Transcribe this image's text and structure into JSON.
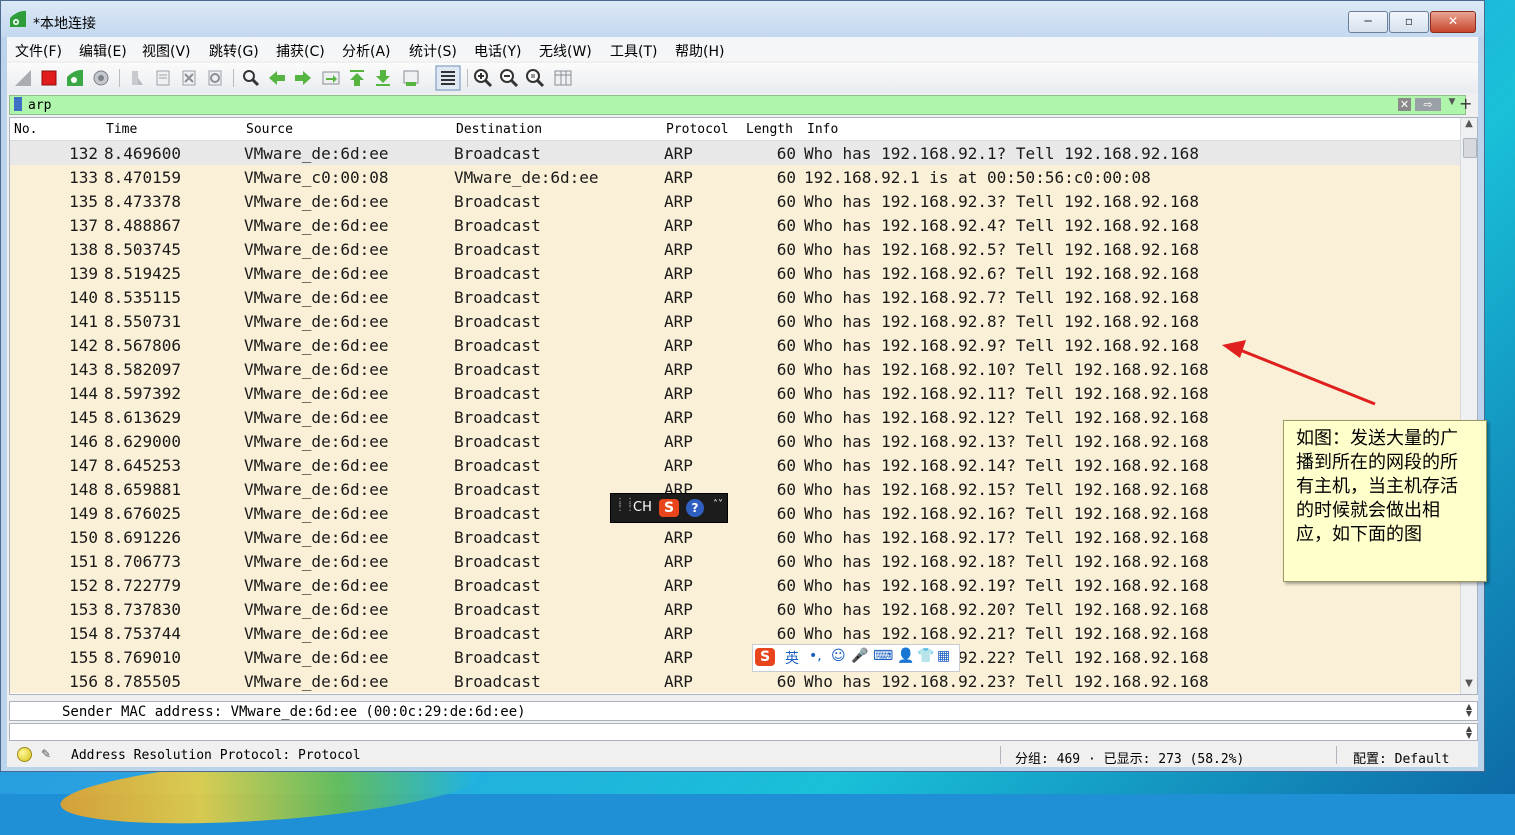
{
  "window": {
    "title": "*本地连接",
    "buttons": {
      "minimize": "─",
      "maximize": "▫",
      "close": "✕"
    }
  },
  "menu": [
    "文件(F)",
    "编辑(E)",
    "视图(V)",
    "跳转(G)",
    "捕获(C)",
    "分析(A)",
    "统计(S)",
    "电话(Y)",
    "无线(W)",
    "工具(T)",
    "帮助(H)"
  ],
  "filter": {
    "value": "arp",
    "clear": "✕",
    "apply": "⇨",
    "dropdown": "▼",
    "add": "+"
  },
  "columns": {
    "no": "No.",
    "time": "Time",
    "source": "Source",
    "destination": "Destination",
    "protocol": "Protocol",
    "length": "Length",
    "info": "Info"
  },
  "packets": [
    {
      "no": "132",
      "time": "8.469600",
      "src": "VMware_de:6d:ee",
      "dst": "Broadcast",
      "proto": "ARP",
      "len": "60",
      "info": "Who has 192.168.92.1? Tell 192.168.92.168"
    },
    {
      "no": "133",
      "time": "8.470159",
      "src": "VMware_c0:00:08",
      "dst": "VMware_de:6d:ee",
      "proto": "ARP",
      "len": "60",
      "info": "192.168.92.1 is at 00:50:56:c0:00:08"
    },
    {
      "no": "135",
      "time": "8.473378",
      "src": "VMware_de:6d:ee",
      "dst": "Broadcast",
      "proto": "ARP",
      "len": "60",
      "info": "Who has 192.168.92.3? Tell 192.168.92.168"
    },
    {
      "no": "137",
      "time": "8.488867",
      "src": "VMware_de:6d:ee",
      "dst": "Broadcast",
      "proto": "ARP",
      "len": "60",
      "info": "Who has 192.168.92.4? Tell 192.168.92.168"
    },
    {
      "no": "138",
      "time": "8.503745",
      "src": "VMware_de:6d:ee",
      "dst": "Broadcast",
      "proto": "ARP",
      "len": "60",
      "info": "Who has 192.168.92.5? Tell 192.168.92.168"
    },
    {
      "no": "139",
      "time": "8.519425",
      "src": "VMware_de:6d:ee",
      "dst": "Broadcast",
      "proto": "ARP",
      "len": "60",
      "info": "Who has 192.168.92.6? Tell 192.168.92.168"
    },
    {
      "no": "140",
      "time": "8.535115",
      "src": "VMware_de:6d:ee",
      "dst": "Broadcast",
      "proto": "ARP",
      "len": "60",
      "info": "Who has 192.168.92.7? Tell 192.168.92.168"
    },
    {
      "no": "141",
      "time": "8.550731",
      "src": "VMware_de:6d:ee",
      "dst": "Broadcast",
      "proto": "ARP",
      "len": "60",
      "info": "Who has 192.168.92.8? Tell 192.168.92.168"
    },
    {
      "no": "142",
      "time": "8.567806",
      "src": "VMware_de:6d:ee",
      "dst": "Broadcast",
      "proto": "ARP",
      "len": "60",
      "info": "Who has 192.168.92.9? Tell 192.168.92.168"
    },
    {
      "no": "143",
      "time": "8.582097",
      "src": "VMware_de:6d:ee",
      "dst": "Broadcast",
      "proto": "ARP",
      "len": "60",
      "info": "Who has 192.168.92.10? Tell 192.168.92.168"
    },
    {
      "no": "144",
      "time": "8.597392",
      "src": "VMware_de:6d:ee",
      "dst": "Broadcast",
      "proto": "ARP",
      "len": "60",
      "info": "Who has 192.168.92.11? Tell 192.168.92.168"
    },
    {
      "no": "145",
      "time": "8.613629",
      "src": "VMware_de:6d:ee",
      "dst": "Broadcast",
      "proto": "ARP",
      "len": "60",
      "info": "Who has 192.168.92.12? Tell 192.168.92.168"
    },
    {
      "no": "146",
      "time": "8.629000",
      "src": "VMware_de:6d:ee",
      "dst": "Broadcast",
      "proto": "ARP",
      "len": "60",
      "info": "Who has 192.168.92.13? Tell 192.168.92.168"
    },
    {
      "no": "147",
      "time": "8.645253",
      "src": "VMware_de:6d:ee",
      "dst": "Broadcast",
      "proto": "ARP",
      "len": "60",
      "info": "Who has 192.168.92.14? Tell 192.168.92.168"
    },
    {
      "no": "148",
      "time": "8.659881",
      "src": "VMware_de:6d:ee",
      "dst": "Broadcast",
      "proto": "ARP",
      "len": "60",
      "info": "Who has 192.168.92.15? Tell 192.168.92.168"
    },
    {
      "no": "149",
      "time": "8.676025",
      "src": "VMware_de:6d:ee",
      "dst": "Broadcast",
      "proto": "",
      "len": "60",
      "info": "Who has 192.168.92.16? Tell 192.168.92.168"
    },
    {
      "no": "150",
      "time": "8.691226",
      "src": "VMware_de:6d:ee",
      "dst": "Broadcast",
      "proto": "ARP",
      "len": "60",
      "info": "Who has 192.168.92.17? Tell 192.168.92.168"
    },
    {
      "no": "151",
      "time": "8.706773",
      "src": "VMware_de:6d:ee",
      "dst": "Broadcast",
      "proto": "ARP",
      "len": "60",
      "info": "Who has 192.168.92.18? Tell 192.168.92.168"
    },
    {
      "no": "152",
      "time": "8.722779",
      "src": "VMware_de:6d:ee",
      "dst": "Broadcast",
      "proto": "ARP",
      "len": "60",
      "info": "Who has 192.168.92.19? Tell 192.168.92.168"
    },
    {
      "no": "153",
      "time": "8.737830",
      "src": "VMware_de:6d:ee",
      "dst": "Broadcast",
      "proto": "ARP",
      "len": "60",
      "info": "Who has 192.168.92.20? Tell 192.168.92.168"
    },
    {
      "no": "154",
      "time": "8.753744",
      "src": "VMware_de:6d:ee",
      "dst": "Broadcast",
      "proto": "ARP",
      "len": "60",
      "info": "Who has 192.168.92.21? Tell 192.168.92.168"
    },
    {
      "no": "155",
      "time": "8.769010",
      "src": "VMware_de:6d:ee",
      "dst": "Broadcast",
      "proto": "ARP",
      "len": "60",
      "info": "Who has 192.168.92.22? Tell 192.168.92.168"
    },
    {
      "no": "156",
      "time": "8.785505",
      "src": "VMware_de:6d:ee",
      "dst": "Broadcast",
      "proto": "ARP",
      "len": "60",
      "info": "Who has 192.168.92.23? Tell 192.168.92.168"
    }
  ],
  "details": {
    "line": "Sender MAC address: VMware_de:6d:ee (00:0c:29:de:6d:ee)"
  },
  "status": {
    "field": "Address Resolution Protocol: Protocol",
    "counts": "分组: 469 · 已显示: 273 (58.2%)",
    "profile": "配置: Default"
  },
  "annotation": {
    "note": "如图：发送大量的广播到所在的网段的所有主机，当主机存活的时候就会做出相应，如下面的图",
    "arrow_color": "#e0201e"
  },
  "ime_bar": {
    "lang": "CH",
    "s": "S",
    "help": "?",
    "menu": "˄˅"
  },
  "ime_toolbar": {
    "s": "S",
    "mode": "英",
    "punct": "•,",
    "emoji": "☺",
    "voice": "🎤",
    "keyboard": "⌨",
    "user": "👤",
    "skin": "👕",
    "apps": "▦"
  },
  "colors": {
    "row_bg": "#faf0d7",
    "filter_bg": "#aff5ac",
    "selected_row": "#e8e8e8"
  }
}
